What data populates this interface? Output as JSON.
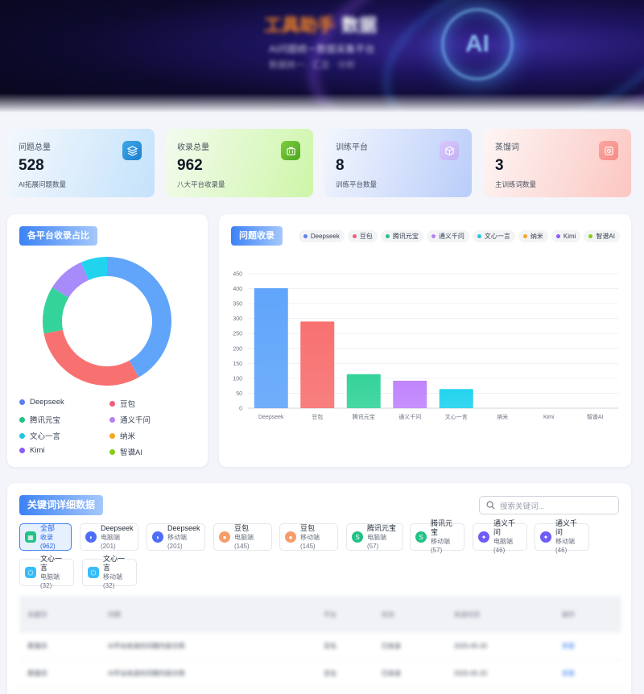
{
  "banner": {
    "title_accent": "工具助手",
    "title_main": "数据",
    "subtitle": "AI问题统一数据采集平台",
    "tagline": "数据统一 · 汇总 · 分析",
    "orb_text": "AI"
  },
  "stats": [
    {
      "label": "问题总量",
      "value": "528",
      "desc": "AI拓展问题数量",
      "icon": "layers-icon"
    },
    {
      "label": "收录总量",
      "value": "962",
      "desc": "八大平台收录量",
      "icon": "briefcase-icon"
    },
    {
      "label": "训练平台",
      "value": "8",
      "desc": "训练平台数量",
      "icon": "cube-icon"
    },
    {
      "label": "蒸馏词",
      "value": "3",
      "desc": "主训练词数量",
      "icon": "ban-icon"
    }
  ],
  "donut_panel": {
    "title": "各平台收录占比",
    "legend": [
      {
        "name": "Deepseek",
        "color": "#5b7ff0"
      },
      {
        "name": "豆包",
        "color": "#f05d7a"
      },
      {
        "name": "腾讯元宝",
        "color": "#22c186"
      },
      {
        "name": "通义千问",
        "color": "#b87ff2"
      },
      {
        "name": "文心一言",
        "color": "#22c5e0"
      },
      {
        "name": "纳米",
        "color": "#f5a623"
      },
      {
        "name": "Kimi",
        "color": "#8b5cf6"
      },
      {
        "name": "智谱AI",
        "color": "#84cc16"
      }
    ]
  },
  "bar_panel": {
    "title": "问题收录",
    "legend": [
      {
        "name": "Deepseek",
        "color": "#5b7ff0"
      },
      {
        "name": "豆包",
        "color": "#f05d7a"
      },
      {
        "name": "腾讯元宝",
        "color": "#22c186"
      },
      {
        "name": "通义千问",
        "color": "#b87ff2"
      },
      {
        "name": "文心一言",
        "color": "#22c5e0"
      },
      {
        "name": "纳米",
        "color": "#f5a623"
      },
      {
        "name": "Kimi",
        "color": "#8b5cf6"
      },
      {
        "name": "智谱AI",
        "color": "#84cc16"
      }
    ]
  },
  "chart_data": [
    {
      "type": "pie",
      "title": "各平台收录占比",
      "categories": [
        "Deepseek",
        "豆包",
        "腾讯元宝",
        "通义千问",
        "文心一言",
        "纳米",
        "Kimi",
        "智谱AI"
      ],
      "values": [
        402,
        290,
        114,
        92,
        64,
        0,
        0,
        0
      ],
      "colors": [
        "#60a5fa",
        "#f87171",
        "#34d399",
        "#a78bfa",
        "#22d3ee",
        "#f5a623",
        "#8b5cf6",
        "#84cc16"
      ]
    },
    {
      "type": "bar",
      "title": "问题收录",
      "categories": [
        "Deepseek",
        "豆包",
        "腾讯元宝",
        "通义千问",
        "文心一言",
        "纳米",
        "Kimi",
        "智谱AI"
      ],
      "values": [
        402,
        290,
        114,
        92,
        64,
        0,
        0,
        0
      ],
      "colors": [
        "#60a5fa",
        "#f87171",
        "#34d399",
        "#c084fc",
        "#22d3ee",
        "#f5a623",
        "#8b5cf6",
        "#84cc16"
      ],
      "ylim": [
        0,
        450
      ],
      "yticks": [
        0,
        50,
        100,
        150,
        200,
        250,
        300,
        350,
        400,
        450
      ],
      "grid": true
    }
  ],
  "keywords": {
    "title": "关键词详细数据",
    "search_placeholder": "搜索关键词...",
    "platforms": [
      {
        "name": "全部",
        "count": "收录(962)",
        "icon": "all-icon",
        "color": "#22c186",
        "active": true
      },
      {
        "name": "Deepseek",
        "count": "电脑端(201)",
        "icon": "whale-icon",
        "color": "#4f6ef7",
        "active": false
      },
      {
        "name": "Deepseek",
        "count": "移动端(201)",
        "icon": "whale-icon",
        "color": "#4f6ef7",
        "active": false
      },
      {
        "name": "豆包",
        "count": "电脑端(145)",
        "icon": "avatar-icon",
        "color": "#f59e6b",
        "active": false
      },
      {
        "name": "豆包",
        "count": "移动端(145)",
        "icon": "avatar-icon",
        "color": "#f59e6b",
        "active": false
      },
      {
        "name": "腾讯元宝",
        "count": "电脑端(57)",
        "icon": "yuanbao-icon",
        "color": "#22c186",
        "active": false
      },
      {
        "name": "腾讯元宝",
        "count": "移动端(57)",
        "icon": "yuanbao-icon",
        "color": "#22c186",
        "active": false
      },
      {
        "name": "通义千问",
        "count": "电脑端(46)",
        "icon": "qwen-icon",
        "color": "#6d5cf6",
        "active": false
      },
      {
        "name": "通义千问",
        "count": "移动端(46)",
        "icon": "qwen-icon",
        "color": "#6d5cf6",
        "active": false
      },
      {
        "name": "文心一言",
        "count": "电脑端(32)",
        "icon": "wenxin-icon",
        "color": "#38bdf8",
        "active": false
      },
      {
        "name": "文心一言",
        "count": "移动端(32)",
        "icon": "wenxin-icon",
        "color": "#38bdf8",
        "active": false
      }
    ],
    "table": {
      "headers": [
        "关键词",
        "问题",
        "平台",
        "状态",
        "收录时间",
        "操作"
      ],
      "rows": [
        [
          "蒸馏词",
          "AI平台收录的问题内容示例",
          "豆包",
          "已收录",
          "2025-05-20",
          "查看"
        ],
        [
          "蒸馏词",
          "AI平台收录的问题内容示例",
          "豆包",
          "已收录",
          "2025-05-20",
          "查看"
        ]
      ]
    }
  }
}
